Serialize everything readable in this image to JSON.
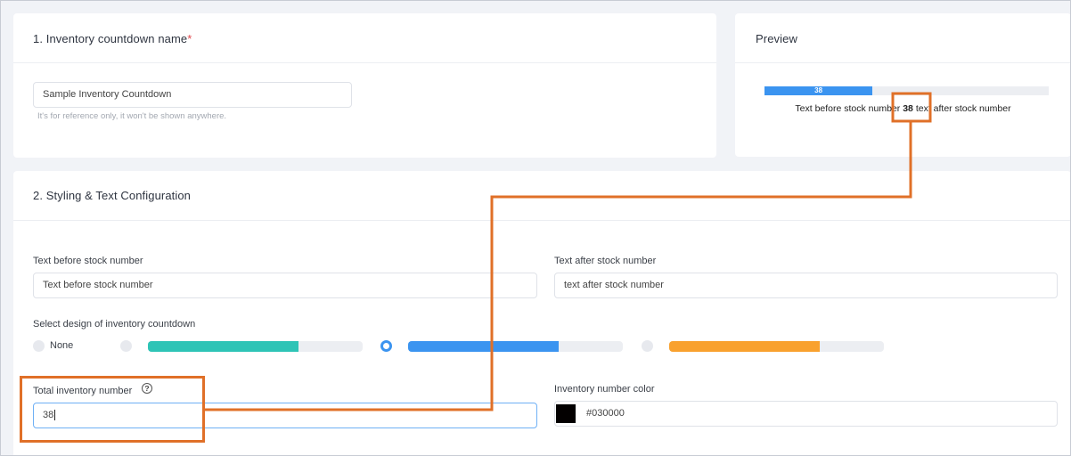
{
  "section_name": {
    "title": "1. Inventory countdown name",
    "required_mark": "*",
    "input_value": "Sample Inventory Countdown",
    "helper": "It's for reference only, it won't be shown anywhere."
  },
  "preview": {
    "title": "Preview",
    "bar_number": "38",
    "bar_fill_fraction": 0.38,
    "text_before": "Text before stock number",
    "number": "38",
    "text_after": "text after stock number"
  },
  "styling": {
    "title": "2. Styling & Text Configuration",
    "text_before_label": "Text before stock number",
    "text_before_value": "Text before stock number",
    "text_after_label": "Text after stock number",
    "text_after_value": "text after stock number",
    "design_label": "Select design of inventory countdown",
    "design_none_label": "None",
    "designs": [
      {
        "color": "#2ec4b6",
        "fill_fraction": 0.7,
        "selected": false
      },
      {
        "color": "#3b94f0",
        "fill_fraction": 0.7,
        "selected": true
      },
      {
        "color": "#f9a12e",
        "fill_fraction": 0.7,
        "selected": false
      }
    ],
    "total_label": "Total inventory number",
    "total_value": "38",
    "color_label": "Inventory number color",
    "color_value": "#030000"
  },
  "colors": {
    "annotation": "#e07028",
    "accent": "#3b94f0"
  }
}
